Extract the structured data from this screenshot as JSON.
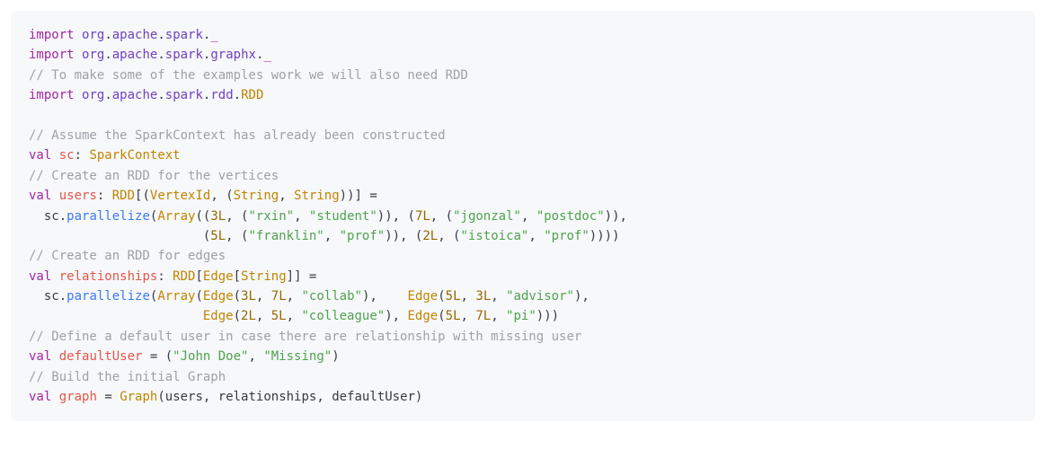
{
  "code": {
    "lines": [
      [
        {
          "cls": "tok-kw",
          "t": "import"
        },
        {
          "cls": "tok-plain",
          "t": " "
        },
        {
          "cls": "tok-pkg",
          "t": "org"
        },
        {
          "cls": "tok-plain",
          "t": "."
        },
        {
          "cls": "tok-pkg",
          "t": "apache"
        },
        {
          "cls": "tok-plain",
          "t": "."
        },
        {
          "cls": "tok-pkg",
          "t": "spark"
        },
        {
          "cls": "tok-plain",
          "t": "."
        },
        {
          "cls": "tok-kw",
          "t": "_"
        }
      ],
      [
        {
          "cls": "tok-kw",
          "t": "import"
        },
        {
          "cls": "tok-plain",
          "t": " "
        },
        {
          "cls": "tok-pkg",
          "t": "org"
        },
        {
          "cls": "tok-plain",
          "t": "."
        },
        {
          "cls": "tok-pkg",
          "t": "apache"
        },
        {
          "cls": "tok-plain",
          "t": "."
        },
        {
          "cls": "tok-pkg",
          "t": "spark"
        },
        {
          "cls": "tok-plain",
          "t": "."
        },
        {
          "cls": "tok-pkg",
          "t": "graphx"
        },
        {
          "cls": "tok-plain",
          "t": "."
        },
        {
          "cls": "tok-kw",
          "t": "_"
        }
      ],
      [
        {
          "cls": "tok-cm",
          "t": "// To make some of the examples work we will also need RDD"
        }
      ],
      [
        {
          "cls": "tok-kw",
          "t": "import"
        },
        {
          "cls": "tok-plain",
          "t": " "
        },
        {
          "cls": "tok-pkg",
          "t": "org"
        },
        {
          "cls": "tok-plain",
          "t": "."
        },
        {
          "cls": "tok-pkg",
          "t": "apache"
        },
        {
          "cls": "tok-plain",
          "t": "."
        },
        {
          "cls": "tok-pkg",
          "t": "spark"
        },
        {
          "cls": "tok-plain",
          "t": "."
        },
        {
          "cls": "tok-pkg",
          "t": "rdd"
        },
        {
          "cls": "tok-plain",
          "t": "."
        },
        {
          "cls": "tok-type",
          "t": "RDD"
        }
      ],
      [
        {
          "cls": "tok-plain",
          "t": ""
        }
      ],
      [
        {
          "cls": "tok-cm",
          "t": "// Assume the SparkContext has already been constructed"
        }
      ],
      [
        {
          "cls": "tok-kw",
          "t": "val"
        },
        {
          "cls": "tok-plain",
          "t": " "
        },
        {
          "cls": "tok-var",
          "t": "sc"
        },
        {
          "cls": "tok-plain",
          "t": ": "
        },
        {
          "cls": "tok-type",
          "t": "SparkContext"
        }
      ],
      [
        {
          "cls": "tok-cm",
          "t": "// Create an RDD for the vertices"
        }
      ],
      [
        {
          "cls": "tok-kw",
          "t": "val"
        },
        {
          "cls": "tok-plain",
          "t": " "
        },
        {
          "cls": "tok-var",
          "t": "users"
        },
        {
          "cls": "tok-plain",
          "t": ": "
        },
        {
          "cls": "tok-type",
          "t": "RDD"
        },
        {
          "cls": "tok-plain",
          "t": "[("
        },
        {
          "cls": "tok-type",
          "t": "VertexId"
        },
        {
          "cls": "tok-plain",
          "t": ", ("
        },
        {
          "cls": "tok-type",
          "t": "String"
        },
        {
          "cls": "tok-plain",
          "t": ", "
        },
        {
          "cls": "tok-type",
          "t": "String"
        },
        {
          "cls": "tok-plain",
          "t": "))] ="
        }
      ],
      [
        {
          "cls": "tok-plain",
          "t": "  sc."
        },
        {
          "cls": "tok-fn",
          "t": "parallelize"
        },
        {
          "cls": "tok-plain",
          "t": "("
        },
        {
          "cls": "tok-type",
          "t": "Array"
        },
        {
          "cls": "tok-plain",
          "t": "(("
        },
        {
          "cls": "tok-num",
          "t": "3L"
        },
        {
          "cls": "tok-plain",
          "t": ", ("
        },
        {
          "cls": "tok-str",
          "t": "\"rxin\""
        },
        {
          "cls": "tok-plain",
          "t": ", "
        },
        {
          "cls": "tok-str",
          "t": "\"student\""
        },
        {
          "cls": "tok-plain",
          "t": ")), ("
        },
        {
          "cls": "tok-num",
          "t": "7L"
        },
        {
          "cls": "tok-plain",
          "t": ", ("
        },
        {
          "cls": "tok-str",
          "t": "\"jgonzal\""
        },
        {
          "cls": "tok-plain",
          "t": ", "
        },
        {
          "cls": "tok-str",
          "t": "\"postdoc\""
        },
        {
          "cls": "tok-plain",
          "t": ")),"
        }
      ],
      [
        {
          "cls": "tok-plain",
          "t": "                       ("
        },
        {
          "cls": "tok-num",
          "t": "5L"
        },
        {
          "cls": "tok-plain",
          "t": ", ("
        },
        {
          "cls": "tok-str",
          "t": "\"franklin\""
        },
        {
          "cls": "tok-plain",
          "t": ", "
        },
        {
          "cls": "tok-str",
          "t": "\"prof\""
        },
        {
          "cls": "tok-plain",
          "t": ")), ("
        },
        {
          "cls": "tok-num",
          "t": "2L"
        },
        {
          "cls": "tok-plain",
          "t": ", ("
        },
        {
          "cls": "tok-str",
          "t": "\"istoica\""
        },
        {
          "cls": "tok-plain",
          "t": ", "
        },
        {
          "cls": "tok-str",
          "t": "\"prof\""
        },
        {
          "cls": "tok-plain",
          "t": "))))"
        }
      ],
      [
        {
          "cls": "tok-cm",
          "t": "// Create an RDD for edges"
        }
      ],
      [
        {
          "cls": "tok-kw",
          "t": "val"
        },
        {
          "cls": "tok-plain",
          "t": " "
        },
        {
          "cls": "tok-var",
          "t": "relationships"
        },
        {
          "cls": "tok-plain",
          "t": ": "
        },
        {
          "cls": "tok-type",
          "t": "RDD"
        },
        {
          "cls": "tok-plain",
          "t": "["
        },
        {
          "cls": "tok-type",
          "t": "Edge"
        },
        {
          "cls": "tok-plain",
          "t": "["
        },
        {
          "cls": "tok-type",
          "t": "String"
        },
        {
          "cls": "tok-plain",
          "t": "]] ="
        }
      ],
      [
        {
          "cls": "tok-plain",
          "t": "  sc."
        },
        {
          "cls": "tok-fn",
          "t": "parallelize"
        },
        {
          "cls": "tok-plain",
          "t": "("
        },
        {
          "cls": "tok-type",
          "t": "Array"
        },
        {
          "cls": "tok-plain",
          "t": "("
        },
        {
          "cls": "tok-type",
          "t": "Edge"
        },
        {
          "cls": "tok-plain",
          "t": "("
        },
        {
          "cls": "tok-num",
          "t": "3L"
        },
        {
          "cls": "tok-plain",
          "t": ", "
        },
        {
          "cls": "tok-num",
          "t": "7L"
        },
        {
          "cls": "tok-plain",
          "t": ", "
        },
        {
          "cls": "tok-str",
          "t": "\"collab\""
        },
        {
          "cls": "tok-plain",
          "t": "),    "
        },
        {
          "cls": "tok-type",
          "t": "Edge"
        },
        {
          "cls": "tok-plain",
          "t": "("
        },
        {
          "cls": "tok-num",
          "t": "5L"
        },
        {
          "cls": "tok-plain",
          "t": ", "
        },
        {
          "cls": "tok-num",
          "t": "3L"
        },
        {
          "cls": "tok-plain",
          "t": ", "
        },
        {
          "cls": "tok-str",
          "t": "\"advisor\""
        },
        {
          "cls": "tok-plain",
          "t": "),"
        }
      ],
      [
        {
          "cls": "tok-plain",
          "t": "                       "
        },
        {
          "cls": "tok-type",
          "t": "Edge"
        },
        {
          "cls": "tok-plain",
          "t": "("
        },
        {
          "cls": "tok-num",
          "t": "2L"
        },
        {
          "cls": "tok-plain",
          "t": ", "
        },
        {
          "cls": "tok-num",
          "t": "5L"
        },
        {
          "cls": "tok-plain",
          "t": ", "
        },
        {
          "cls": "tok-str",
          "t": "\"colleague\""
        },
        {
          "cls": "tok-plain",
          "t": "), "
        },
        {
          "cls": "tok-type",
          "t": "Edge"
        },
        {
          "cls": "tok-plain",
          "t": "("
        },
        {
          "cls": "tok-num",
          "t": "5L"
        },
        {
          "cls": "tok-plain",
          "t": ", "
        },
        {
          "cls": "tok-num",
          "t": "7L"
        },
        {
          "cls": "tok-plain",
          "t": ", "
        },
        {
          "cls": "tok-str",
          "t": "\"pi\""
        },
        {
          "cls": "tok-plain",
          "t": ")))"
        }
      ],
      [
        {
          "cls": "tok-cm",
          "t": "// Define a default user in case there are relationship with missing user"
        }
      ],
      [
        {
          "cls": "tok-kw",
          "t": "val"
        },
        {
          "cls": "tok-plain",
          "t": " "
        },
        {
          "cls": "tok-var",
          "t": "defaultUser"
        },
        {
          "cls": "tok-plain",
          "t": " = ("
        },
        {
          "cls": "tok-str",
          "t": "\"John Doe\""
        },
        {
          "cls": "tok-plain",
          "t": ", "
        },
        {
          "cls": "tok-str",
          "t": "\"Missing\""
        },
        {
          "cls": "tok-plain",
          "t": ")"
        }
      ],
      [
        {
          "cls": "tok-cm",
          "t": "// Build the initial Graph"
        }
      ],
      [
        {
          "cls": "tok-kw",
          "t": "val"
        },
        {
          "cls": "tok-plain",
          "t": " "
        },
        {
          "cls": "tok-var",
          "t": "graph"
        },
        {
          "cls": "tok-plain",
          "t": " = "
        },
        {
          "cls": "tok-type",
          "t": "Graph"
        },
        {
          "cls": "tok-plain",
          "t": "(users, relationships, defaultUser)"
        }
      ]
    ]
  }
}
